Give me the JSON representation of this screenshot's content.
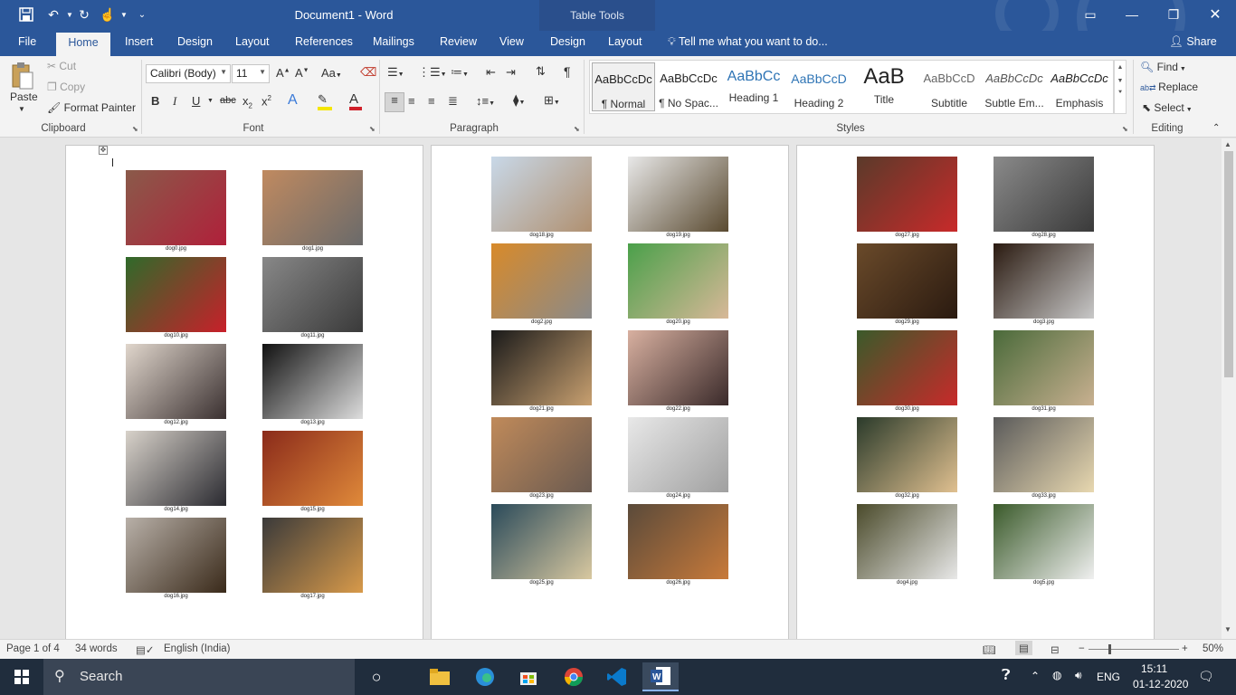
{
  "window": {
    "title": "Document1 - Word",
    "context_tab_group": "Table Tools"
  },
  "ribbon_tabs": [
    "File",
    "Home",
    "Insert",
    "Design",
    "Layout",
    "References",
    "Mailings",
    "Review",
    "View",
    "Design",
    "Layout"
  ],
  "active_tab": "Home",
  "tell_me": "Tell me what you want to do...",
  "share": "Share",
  "clipboard": {
    "paste": "Paste",
    "cut": "Cut",
    "copy": "Copy",
    "format_painter": "Format Painter",
    "label": "Clipboard"
  },
  "font": {
    "family": "Calibri (Body)",
    "size": "11",
    "label": "Font"
  },
  "paragraph": {
    "label": "Paragraph"
  },
  "styles": {
    "label": "Styles",
    "items": [
      {
        "preview": "AaBbCcDc",
        "name": "¶ Normal"
      },
      {
        "preview": "AaBbCcDc",
        "name": "¶ No Spac..."
      },
      {
        "preview": "AaBbCc",
        "name": "Heading 1"
      },
      {
        "preview": "AaBbCcD",
        "name": "Heading 2"
      },
      {
        "preview": "AaB",
        "name": "Title"
      },
      {
        "preview": "AaBbCcD",
        "name": "Subtitle"
      },
      {
        "preview": "AaBbCcDc",
        "name": "Subtle Em..."
      },
      {
        "preview": "AaBbCcDc",
        "name": "Emphasis"
      }
    ]
  },
  "editing": {
    "find": "Find",
    "replace": "Replace",
    "select": "Select",
    "label": "Editing"
  },
  "pages": [
    {
      "cells": [
        {
          "caption": "dog0.jpg",
          "colors": [
            "#8a5a4a",
            "#b0203a"
          ]
        },
        {
          "caption": "dog1.jpg",
          "colors": [
            "#c08a60",
            "#6a6a6a"
          ]
        },
        {
          "caption": "dog10.jpg",
          "colors": [
            "#2f6a2a",
            "#c8202a"
          ]
        },
        {
          "caption": "dog11.jpg",
          "colors": [
            "#888888",
            "#3a3a3a"
          ]
        },
        {
          "caption": "dog12.jpg",
          "colors": [
            "#e0d6cc",
            "#3a3030"
          ]
        },
        {
          "caption": "dog13.jpg",
          "colors": [
            "#111111",
            "#dddddd"
          ]
        },
        {
          "caption": "dog14.jpg",
          "colors": [
            "#d8d2ca",
            "#2a2a30"
          ]
        },
        {
          "caption": "dog15.jpg",
          "colors": [
            "#8a2a1a",
            "#e08a3a"
          ]
        },
        {
          "caption": "dog16.jpg",
          "colors": [
            "#b8b0a8",
            "#3a2a1a"
          ]
        },
        {
          "caption": "dog17.jpg",
          "colors": [
            "#3a3a3a",
            "#d89a4a"
          ]
        }
      ]
    },
    {
      "cells": [
        {
          "caption": "dog18.jpg",
          "colors": [
            "#c8d8e8",
            "#b09070"
          ]
        },
        {
          "caption": "dog19.jpg",
          "colors": [
            "#e8e8e8",
            "#5a4a30"
          ]
        },
        {
          "caption": "dog2.jpg",
          "colors": [
            "#d88a2a",
            "#8a8a8a"
          ]
        },
        {
          "caption": "dog20.jpg",
          "colors": [
            "#4aa04a",
            "#d8b898"
          ]
        },
        {
          "caption": "dog21.jpg",
          "colors": [
            "#1a1a1a",
            "#c8a070"
          ]
        },
        {
          "caption": "dog22.jpg",
          "colors": [
            "#d8b0a0",
            "#3a2a2a"
          ]
        },
        {
          "caption": "dog23.jpg",
          "colors": [
            "#c08a5a",
            "#6a5a50"
          ]
        },
        {
          "caption": "dog24.jpg",
          "colors": [
            "#e8e8e8",
            "#a0a0a0"
          ]
        },
        {
          "caption": "dog25.jpg",
          "colors": [
            "#2a4a5a",
            "#d8c8a0"
          ]
        },
        {
          "caption": "dog26.jpg",
          "colors": [
            "#5a4a3a",
            "#c87a3a"
          ]
        }
      ]
    },
    {
      "cells": [
        {
          "caption": "dog27.jpg",
          "colors": [
            "#5a3a2a",
            "#c82a2a"
          ]
        },
        {
          "caption": "dog28.jpg",
          "colors": [
            "#8a8a8a",
            "#3a3a3a"
          ]
        },
        {
          "caption": "dog29.jpg",
          "colors": [
            "#6a4a2a",
            "#2a1a10"
          ]
        },
        {
          "caption": "dog3.jpg",
          "colors": [
            "#2a1a10",
            "#c8c8c8"
          ]
        },
        {
          "caption": "dog30.jpg",
          "colors": [
            "#3a5a2a",
            "#c82a2a"
          ]
        },
        {
          "caption": "dog31.jpg",
          "colors": [
            "#4a6a3a",
            "#c8b090"
          ]
        },
        {
          "caption": "dog32.jpg",
          "colors": [
            "#2a3a2a",
            "#e0c090"
          ]
        },
        {
          "caption": "dog33.jpg",
          "colors": [
            "#5a5a5a",
            "#e8d8b0"
          ]
        },
        {
          "caption": "dog4.jpg",
          "colors": [
            "#4a4a2a",
            "#e8e8e8"
          ]
        },
        {
          "caption": "dog5.jpg",
          "colors": [
            "#3a5a2a",
            "#f0f0f0"
          ]
        }
      ]
    }
  ],
  "status": {
    "page": "Page 1 of 4",
    "words": "34 words",
    "language": "English (India)",
    "zoom": "50%"
  },
  "taskbar": {
    "search": "Search",
    "lang": "ENG",
    "time": "15:11",
    "date": "01-12-2020"
  },
  "colors": {
    "word_blue": "#2b579a",
    "ribbon_bg": "#f3f3f3",
    "taskbar_bg": "#202d3d"
  }
}
